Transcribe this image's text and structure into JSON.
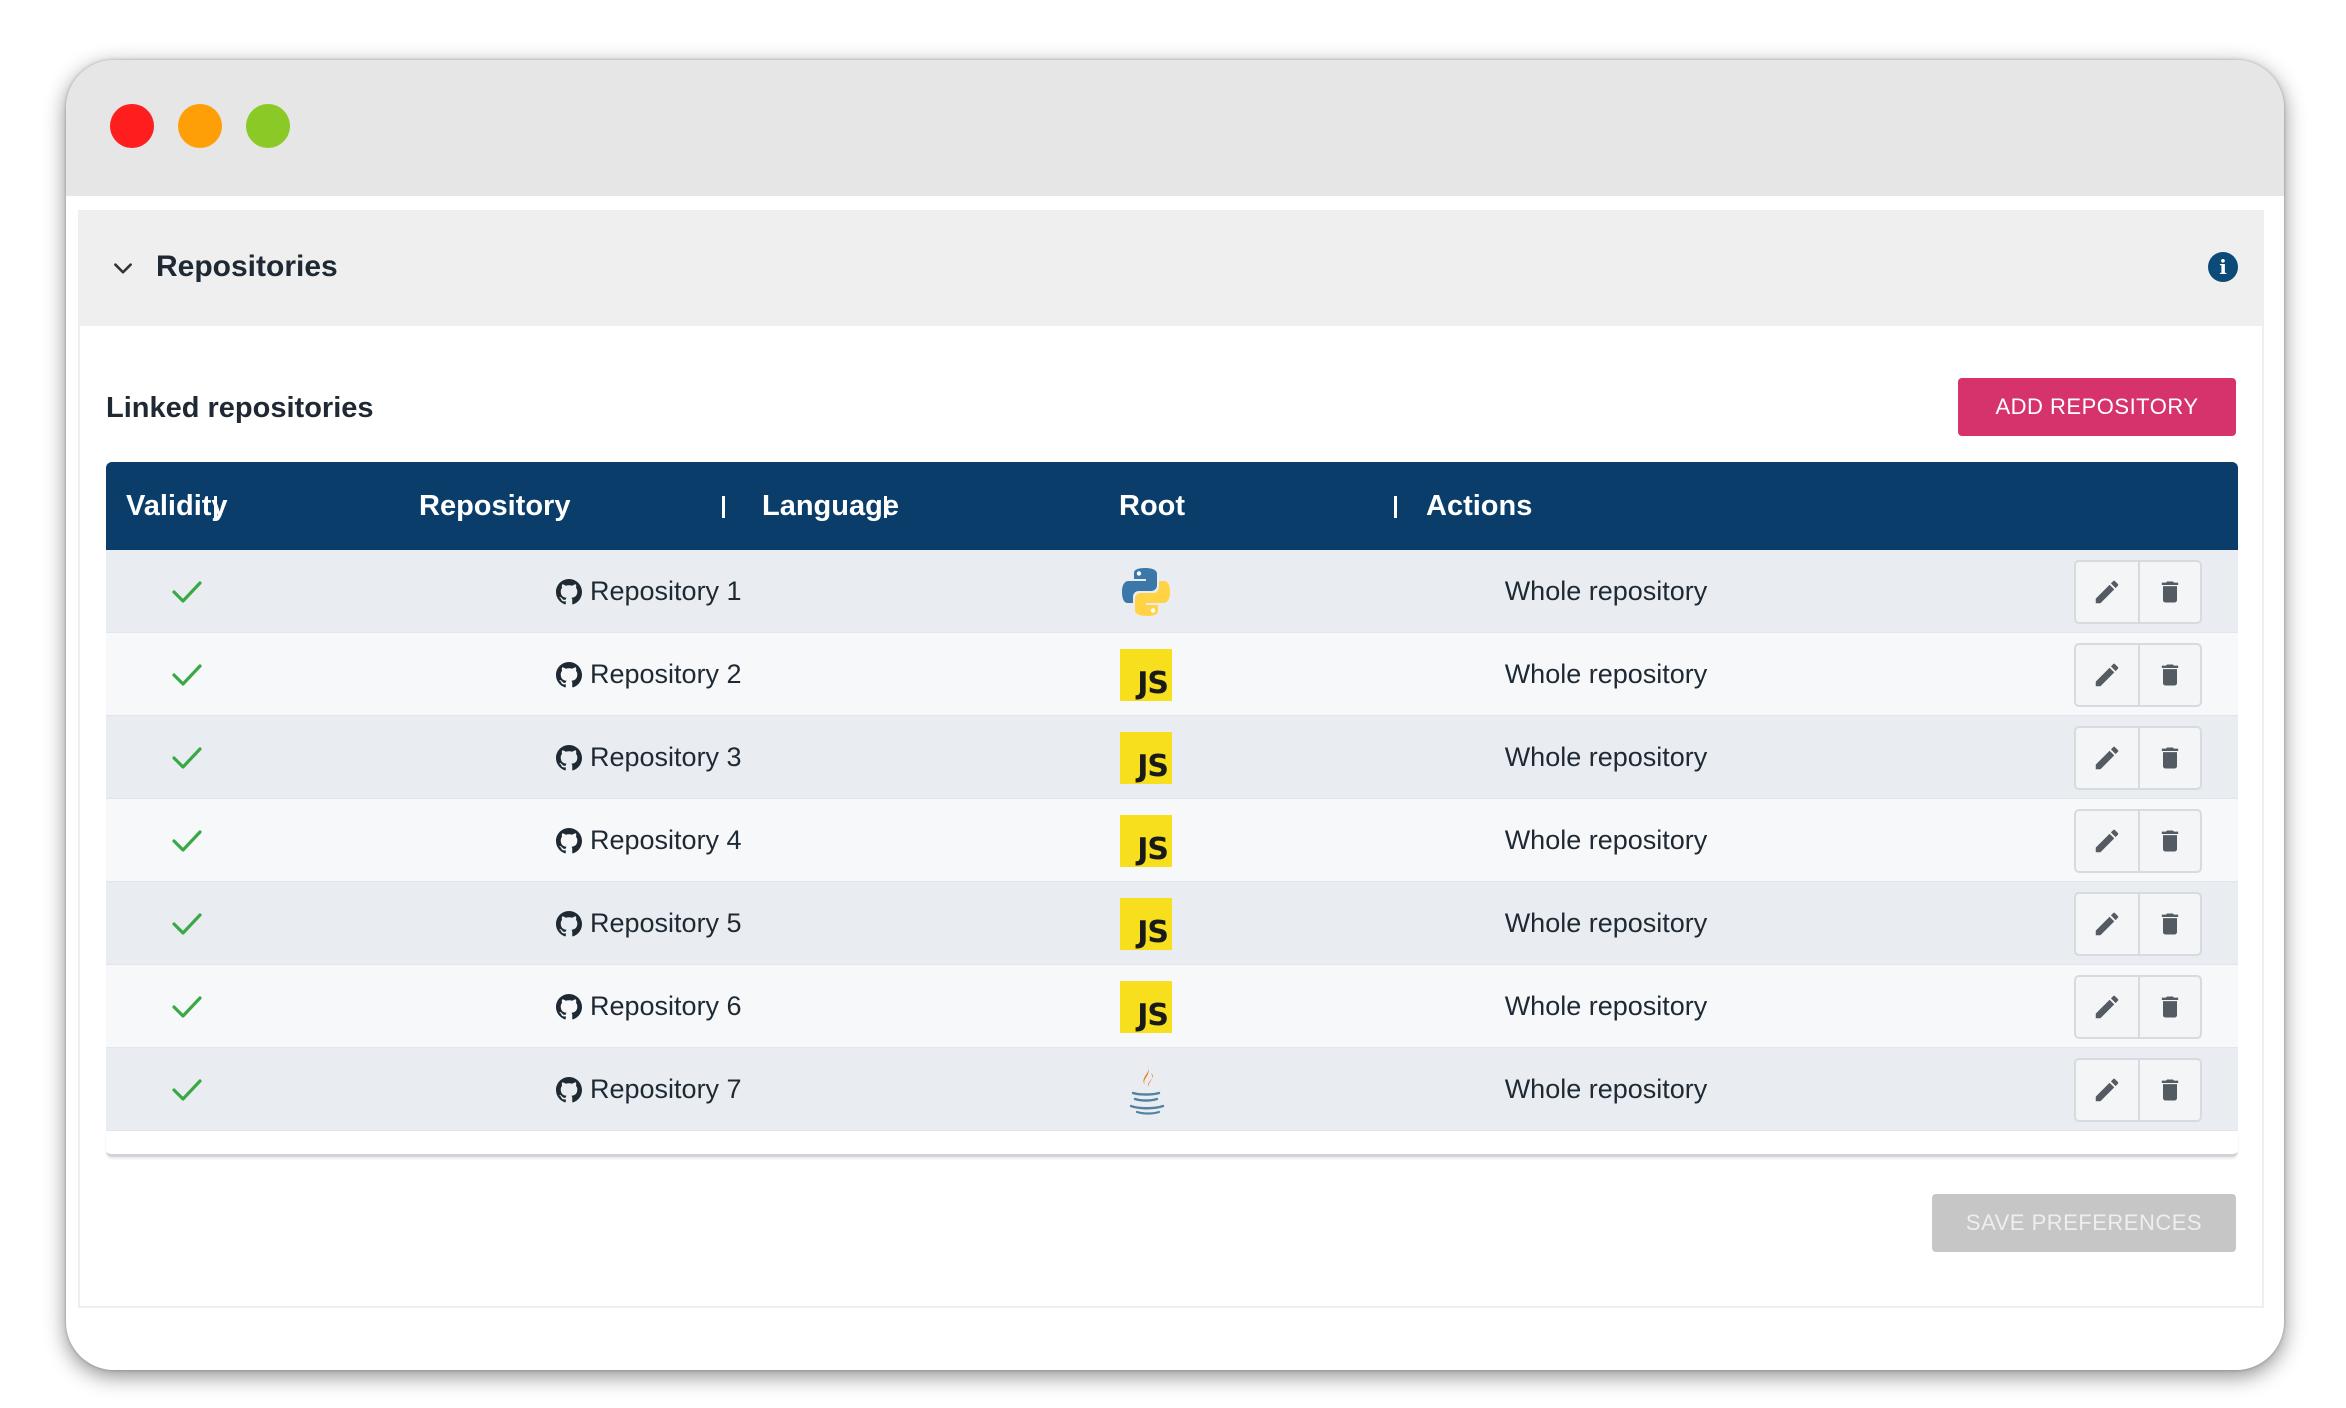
{
  "window": {
    "traffic_lights": [
      "close",
      "minimize",
      "maximize"
    ],
    "colors": {
      "close": "#fe1e1e",
      "minimize": "#ff9f07",
      "maximize": "#8ac926"
    }
  },
  "panel": {
    "title": "Repositories",
    "collapse_icon": "chevron-down-icon",
    "info_icon": "info-icon"
  },
  "section": {
    "title": "Linked repositories",
    "add_button": "ADD REPOSITORY",
    "save_button": "SAVE PREFERENCES"
  },
  "table": {
    "headers": [
      "Validity",
      "Repository",
      "Language",
      "Root",
      "Actions"
    ],
    "rows": [
      {
        "valid": true,
        "repository": "Repository 1",
        "language": "python",
        "root": "Whole repository"
      },
      {
        "valid": true,
        "repository": "Repository 2",
        "language": "js",
        "root": "Whole repository"
      },
      {
        "valid": true,
        "repository": "Repository 3",
        "language": "js",
        "root": "Whole repository"
      },
      {
        "valid": true,
        "repository": "Repository 4",
        "language": "js",
        "root": "Whole repository"
      },
      {
        "valid": true,
        "repository": "Repository 5",
        "language": "js",
        "root": "Whole repository"
      },
      {
        "valid": true,
        "repository": "Repository 6",
        "language": "js",
        "root": "Whole repository"
      },
      {
        "valid": true,
        "repository": "Repository 7",
        "language": "java",
        "root": "Whole repository"
      }
    ],
    "js_badge_text": "JS",
    "action_icons": [
      "pencil-icon",
      "trash-icon"
    ]
  },
  "colors": {
    "header_bg": "#0a3d69",
    "accent": "#d6336c",
    "check": "#3aa845",
    "disabled": "#c6c6c6"
  }
}
